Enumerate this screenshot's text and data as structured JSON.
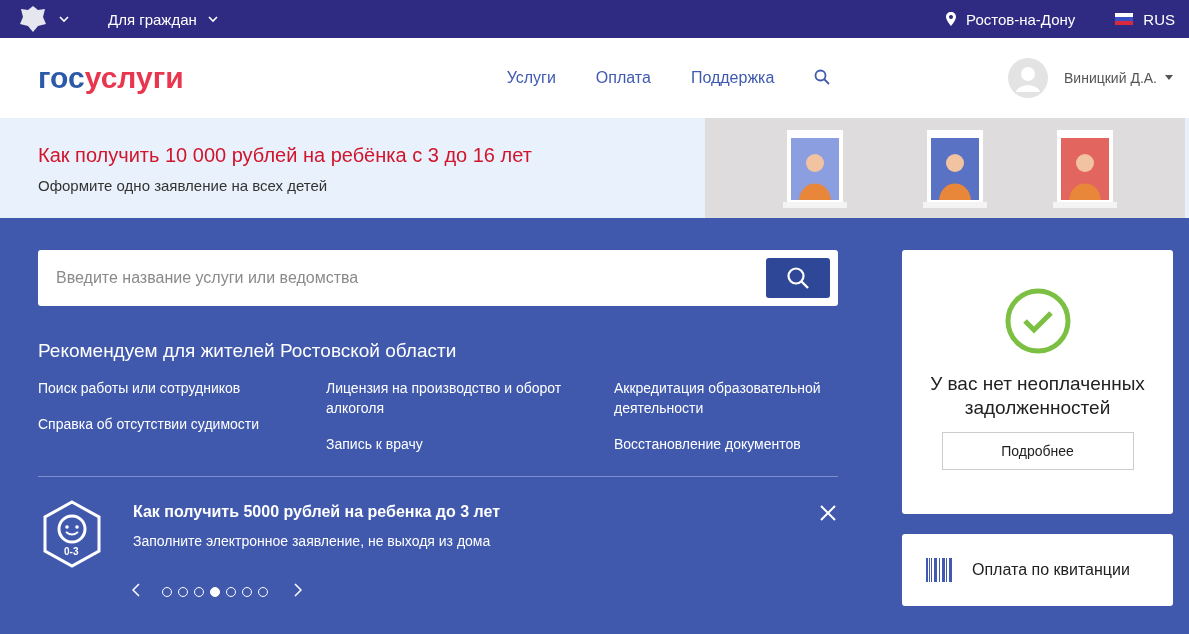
{
  "top_bar": {
    "audience": "Для граждан",
    "city": "Ростов-на-Дону",
    "language": "RUS"
  },
  "header": {
    "logo": {
      "first": "гос",
      "second": "услуги"
    },
    "nav": [
      "Услуги",
      "Оплата",
      "Поддержка"
    ],
    "user": "Виницкий Д.А."
  },
  "banner": {
    "title": "Как получить 10 000 рублей на ребёнка с 3 до 16 лет",
    "subtitle": "Оформите одно заявление на всех детей"
  },
  "search": {
    "placeholder": "Введите название услуги или ведомства"
  },
  "recommended": {
    "title": "Рекомендуем для жителей Ростовской области",
    "columns": [
      [
        "Поиск работы или сотрудников",
        "Справка об отсутствии судимости"
      ],
      [
        "Лицензия на производство и оборот алкоголя",
        "Запись к врачу"
      ],
      [
        "Аккредитация образовательной деятельности",
        "Восстановление документов"
      ]
    ]
  },
  "promo": {
    "icon_label": "0-3",
    "title": "Как получить 5000 рублей на ребенка до 3 лет",
    "text": "Заполните электронное заявление, не выходя из дома",
    "dots": [
      {
        "selected": false
      },
      {
        "selected": false
      },
      {
        "selected": false
      },
      {
        "selected": true
      },
      {
        "selected": false
      },
      {
        "selected": false
      },
      {
        "selected": false
      }
    ]
  },
  "debt_card": {
    "text": "У вас нет неоплаченных задолженностей",
    "button": "Подробнее"
  },
  "receipt_card": {
    "text": "Оплата по квитанции"
  }
}
